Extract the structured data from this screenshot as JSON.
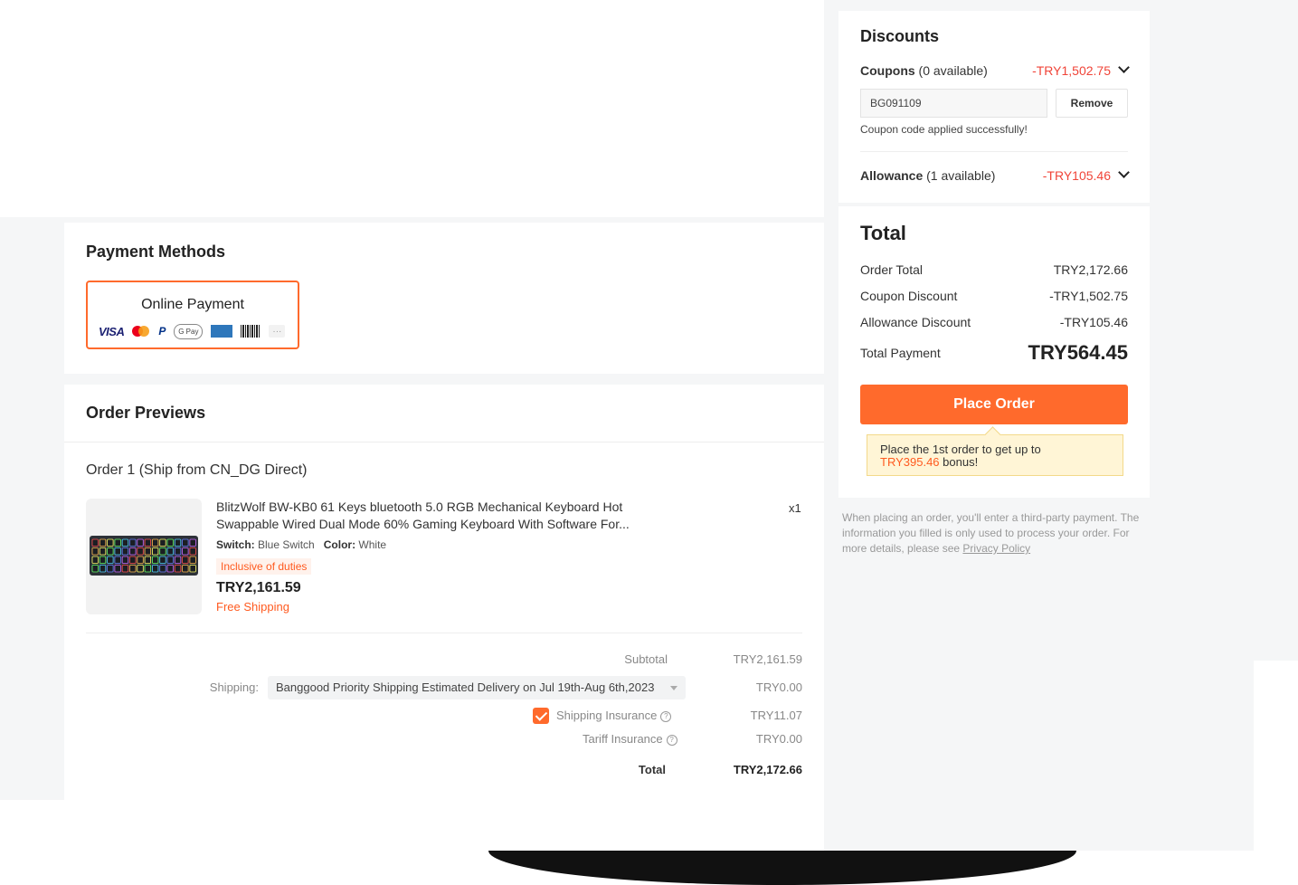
{
  "payment": {
    "title": "Payment Methods",
    "option_label": "Online Payment",
    "icons": [
      "visa-icon",
      "mastercard-icon",
      "paypal-icon",
      "google-pay-icon",
      "amex-icon",
      "barcode-icon",
      "more-icon"
    ],
    "visa_text": "VISA",
    "paypal_text": "P",
    "gpay_text": "G Pay",
    "more_text": "···"
  },
  "orders": {
    "title": "Order Previews",
    "order_label": "Order 1 (Ship from CN_DG Direct)",
    "product": {
      "title": "BlitzWolf BW-KB0 61 Keys bluetooth 5.0 RGB Mechanical Keyboard Hot Swappable Wired Dual Mode 60% Gaming Keyboard With Software For...",
      "switch_label": "Switch:",
      "switch_value": "Blue Switch",
      "color_label": "Color:",
      "color_value": "White",
      "tag": "Inclusive of duties",
      "price": "TRY2,161.59",
      "shipping_note": "Free Shipping",
      "quantity": "x1"
    },
    "summary": {
      "subtotal_label": "Subtotal",
      "subtotal_value": "TRY2,161.59",
      "shipping_label": "Shipping:",
      "shipping_method": "Banggood Priority Shipping Estimated Delivery on Jul 19th-Aug 6th,2023",
      "shipping_value": "TRY0.00",
      "insurance_label": "Shipping Insurance",
      "insurance_checked": true,
      "insurance_value": "TRY11.07",
      "tariff_label": "Tariff Insurance",
      "tariff_value": "TRY0.00",
      "total_label": "Total",
      "total_value": "TRY2,172.66"
    }
  },
  "discounts": {
    "title": "Discounts",
    "coupons_label": "Coupons",
    "coupons_available": "(0 available)",
    "coupons_value": "-TRY1,502.75",
    "coupon_code": "BG091109",
    "remove_label": "Remove",
    "coupon_message": "Coupon code applied successfully!",
    "allowance_label": "Allowance",
    "allowance_available": "(1 available)",
    "allowance_value": "-TRY105.46"
  },
  "total": {
    "title": "Total",
    "rows": [
      {
        "label": "Order Total",
        "value": "TRY2,172.66"
      },
      {
        "label": "Coupon Discount",
        "value": "-TRY1,502.75"
      },
      {
        "label": "Allowance Discount",
        "value": "-TRY105.46"
      }
    ],
    "payment_label": "Total Payment",
    "payment_value": "TRY564.45",
    "place_order_label": "Place Order",
    "bonus_prefix": "Place the 1st order to get up to",
    "bonus_amount": "TRY395.46",
    "bonus_suffix": "bonus!"
  },
  "notice": {
    "text": "When placing an order, you'll enter a third-party payment. The information you filled is only used to process your order. For more details, please see",
    "link": "Privacy Policy"
  },
  "colors": {
    "accent": "#ff6a2c",
    "discount_red": "#f04438",
    "page_bg": "#f5f6f7"
  }
}
